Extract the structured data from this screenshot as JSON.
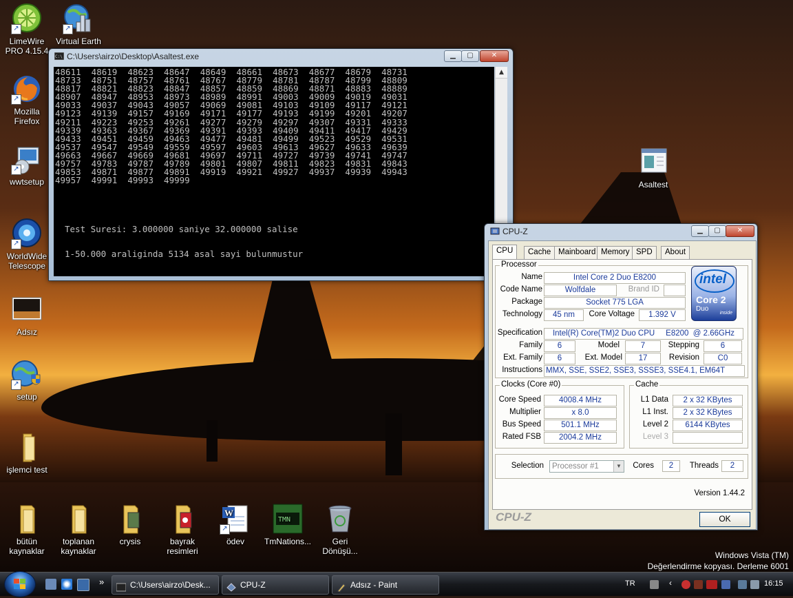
{
  "desktop": {
    "icons": [
      {
        "label": "LimeWire PRO 4.15.4",
        "line1": "LimeWire",
        "line2": "PRO 4.15.4"
      },
      {
        "label": "Virtual Earth",
        "line1": "Virtual Earth",
        "line2": ""
      },
      {
        "label": "Mozilla Firefox",
        "line1": "Mozilla",
        "line2": "Firefox"
      },
      {
        "label": "wwtsetup",
        "line1": "wwtsetup",
        "line2": ""
      },
      {
        "label": "WorldWide Telescope",
        "line1": "WorldWide",
        "line2": "Telescope"
      },
      {
        "label": "Adsız",
        "line1": "Adsız",
        "line2": ""
      },
      {
        "label": "setup",
        "line1": "setup",
        "line2": ""
      },
      {
        "label": "işlemci test",
        "line1": "işlemci test",
        "line2": ""
      },
      {
        "label": "bütün kaynaklar",
        "line1": "bütün",
        "line2": "kaynaklar"
      },
      {
        "label": "toplanan kaynaklar",
        "line1": "toplanan",
        "line2": "kaynaklar"
      },
      {
        "label": "crysis",
        "line1": "crysis",
        "line2": ""
      },
      {
        "label": "bayrak resimleri",
        "line1": "bayrak",
        "line2": "resimleri"
      },
      {
        "label": "ödev",
        "line1": "ödev",
        "line2": ""
      },
      {
        "label": "TmNations...",
        "line1": "TmNations...",
        "line2": ""
      },
      {
        "label": "Geri Dönüşü...",
        "line1": "Geri",
        "line2": "Dönüşü..."
      },
      {
        "label": "Asaltest",
        "line1": "Asaltest",
        "line2": ""
      }
    ],
    "watermark_line1": "Windows Vista (TM)",
    "watermark_line2": "Değerlendirme kopyası. Derleme 6001"
  },
  "console": {
    "title": "C:\\Users\\airzo\\Desktop\\Asaltest.exe",
    "lines": [
      "48611  48619  48623  48647  48649  48661  48673  48677  48679  48731",
      "48733  48751  48757  48761  48767  48779  48781  48787  48799  48809",
      "48817  48821  48823  48847  48857  48859  48869  48871  48883  48889",
      "48907  48947  48953  48973  48989  48991  49003  49009  49019  49031",
      "49033  49037  49043  49057  49069  49081  49103  49109  49117  49121",
      "49123  49139  49157  49169  49171  49177  49193  49199  49201  49207",
      "49211  49223  49253  49261  49277  49279  49297  49307  49331  49333",
      "49339  49363  49367  49369  49391  49393  49409  49411  49417  49429",
      "49433  49451  49459  49463  49477  49481  49499  49523  49529  49531",
      "49537  49547  49549  49559  49597  49603  49613  49627  49633  49639",
      "49663  49667  49669  49681  49697  49711  49727  49739  49741  49747",
      "49757  49783  49787  49789  49801  49807  49811  49823  49831  49843",
      "49853  49871  49877  49891  49919  49921  49927  49937  49939  49943",
      "49957  49991  49993  49999"
    ],
    "test_time": "Test Suresi: 3.000000 saniye 32.000000 salise",
    "result": "1-50.000 araliginda 5134 asal sayi bulunmustur"
  },
  "cpuz": {
    "title": "CPU-Z",
    "tabs": [
      "CPU",
      "Cache",
      "Mainboard",
      "Memory",
      "SPD",
      "About"
    ],
    "processor": {
      "group_label": "Processor",
      "name_label": "Name",
      "name": "Intel Core 2 Duo E8200",
      "codename_label": "Code Name",
      "codename": "Wolfdale",
      "brandid_label": "Brand ID",
      "brandid": "",
      "package_label": "Package",
      "package": "Socket 775 LGA",
      "technology_label": "Technology",
      "technology": "45 nm",
      "corevoltage_label": "Core Voltage",
      "corevoltage": "1.392 V",
      "spec_label": "Specification",
      "spec": "Intel(R) Core(TM)2 Duo CPU     E8200  @ 2.66GHz",
      "family_label": "Family",
      "family": "6",
      "model_label": "Model",
      "model": "7",
      "stepping_label": "Stepping",
      "stepping": "6",
      "extfamily_label": "Ext. Family",
      "extfamily": "6",
      "extmodel_label": "Ext. Model",
      "extmodel": "17",
      "revision_label": "Revision",
      "revision": "C0",
      "instructions_label": "Instructions",
      "instructions": "MMX, SSE, SSE2, SSE3, SSSE3, SSE4.1, EM64T"
    },
    "logo": {
      "brand": "intel",
      "line1": "Core 2",
      "line2": "Duo",
      "line3": "inside"
    },
    "clocks": {
      "group_label": "Clocks (Core #0)",
      "corespeed_label": "Core Speed",
      "corespeed": "4008.4 MHz",
      "multiplier_label": "Multiplier",
      "multiplier": "x 8.0",
      "busspeed_label": "Bus Speed",
      "busspeed": "501.1 MHz",
      "ratedfsb_label": "Rated FSB",
      "ratedfsb": "2004.2 MHz"
    },
    "cache": {
      "group_label": "Cache",
      "l1data_label": "L1 Data",
      "l1data": "2 x 32 KBytes",
      "l1inst_label": "L1 Inst.",
      "l1inst": "2 x 32 KBytes",
      "level2_label": "Level 2",
      "level2": "6144 KBytes",
      "level3_label": "Level 3",
      "level3": ""
    },
    "selection_label": "Selection",
    "selection": "Processor #1",
    "cores_label": "Cores",
    "cores": "2",
    "threads_label": "Threads",
    "threads": "2",
    "version": "Version 1.44.2",
    "brand_footer": "CPU-Z",
    "ok_label": "OK"
  },
  "taskbar": {
    "tasks": [
      "C:\\Users\\airzo\\Desk...",
      "CPU-Z",
      "Adsız - Paint"
    ],
    "language": "TR",
    "clock": "16:15",
    "overflow": "»"
  }
}
